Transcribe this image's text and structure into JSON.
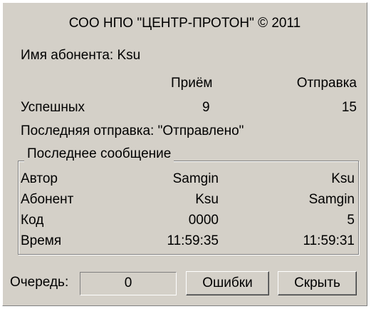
{
  "title": "СОО НПО \"ЦЕНТР-ПРОТОН\" © 2011",
  "subscriber": {
    "label": "Имя абонента:",
    "value": "Ksu"
  },
  "stats": {
    "col_receive": "Приём",
    "col_send": "Отправка",
    "row_label": "Успешных",
    "receive_value": "9",
    "send_value": "15"
  },
  "last_send": {
    "label": "Последняя отправка:",
    "value": "\"Отправлено\""
  },
  "last_message": {
    "legend": "Последнее сообщение",
    "rows": [
      {
        "label": "Автор",
        "receive": "Samgin",
        "send": "Ksu"
      },
      {
        "label": "Абонент",
        "receive": "Ksu",
        "send": "Samgin"
      },
      {
        "label": "Код",
        "receive": "0000",
        "send": "5"
      },
      {
        "label": "Время",
        "receive": "11:59:35",
        "send": "11:59:31"
      }
    ]
  },
  "queue": {
    "label": "Очередь:",
    "value": "0"
  },
  "buttons": {
    "errors": "Ошибки",
    "hide": "Скрыть"
  }
}
